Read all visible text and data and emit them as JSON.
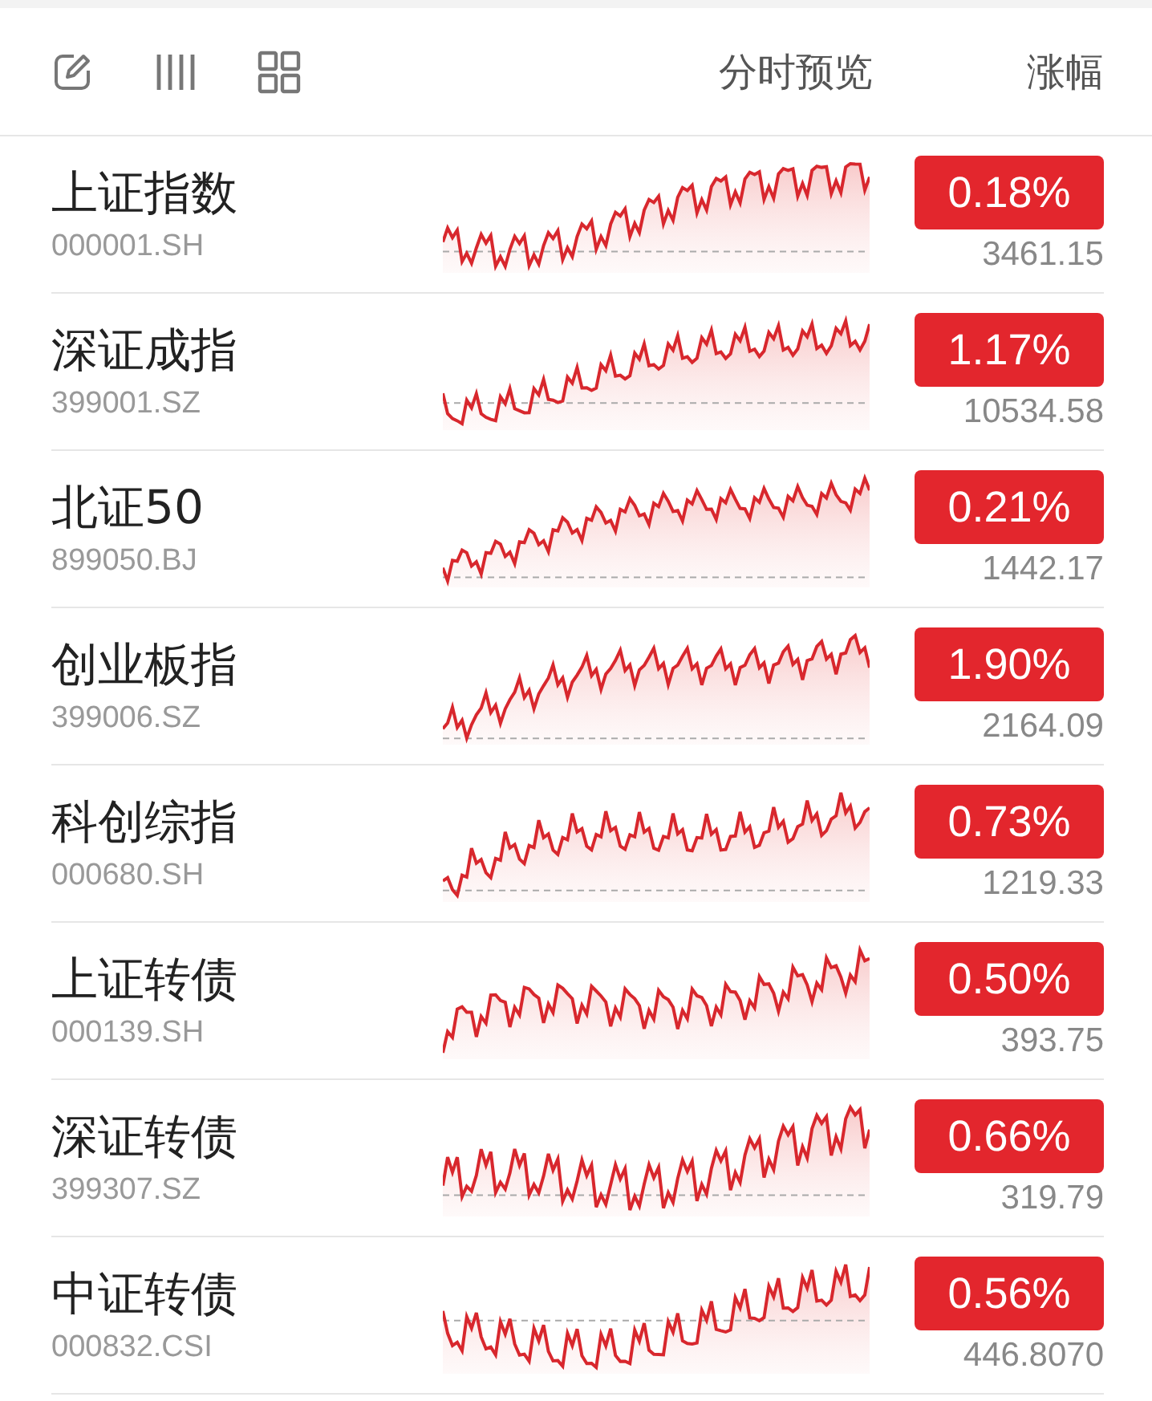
{
  "header": {
    "preview_label": "分时预览",
    "change_label": "涨幅"
  },
  "rows": [
    {
      "name": "上证指数",
      "code": "000001.SH",
      "change": "0.18%",
      "price": "3461.15"
    },
    {
      "name": "深证成指",
      "code": "399001.SZ",
      "change": "1.17%",
      "price": "10534.58"
    },
    {
      "name": "北证50",
      "code": "899050.BJ",
      "change": "0.21%",
      "price": "1442.17"
    },
    {
      "name": "创业板指",
      "code": "399006.SZ",
      "change": "1.90%",
      "price": "2164.09"
    },
    {
      "name": "科创综指",
      "code": "000680.SH",
      "change": "0.73%",
      "price": "1219.33"
    },
    {
      "name": "上证转债",
      "code": "000139.SH",
      "change": "0.50%",
      "price": "393.75"
    },
    {
      "name": "深证转债",
      "code": "399307.SZ",
      "change": "0.66%",
      "price": "319.79"
    },
    {
      "name": "中证转债",
      "code": "000832.CSI",
      "change": "0.56%",
      "price": "446.8070"
    }
  ]
}
